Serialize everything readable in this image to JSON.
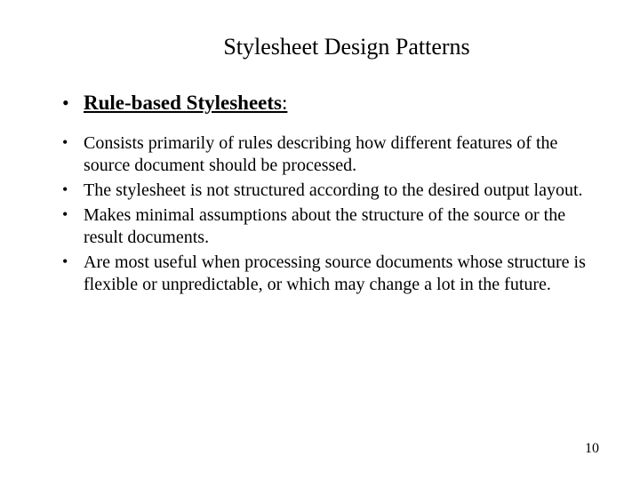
{
  "title": "Stylesheet Design Patterns",
  "section": {
    "heading": "Rule-based Stylesheets",
    "colon": ":"
  },
  "bullets": [
    "Consists primarily of rules describing how different features of the source document should be processed.",
    "The stylesheet is not structured according to the desired output layout.",
    "Makes minimal assumptions about the structure of the source or the result documents.",
    "Are most useful when processing source documents whose structure is flexible or unpredictable, or which may change a lot in the future."
  ],
  "page_number": "10"
}
